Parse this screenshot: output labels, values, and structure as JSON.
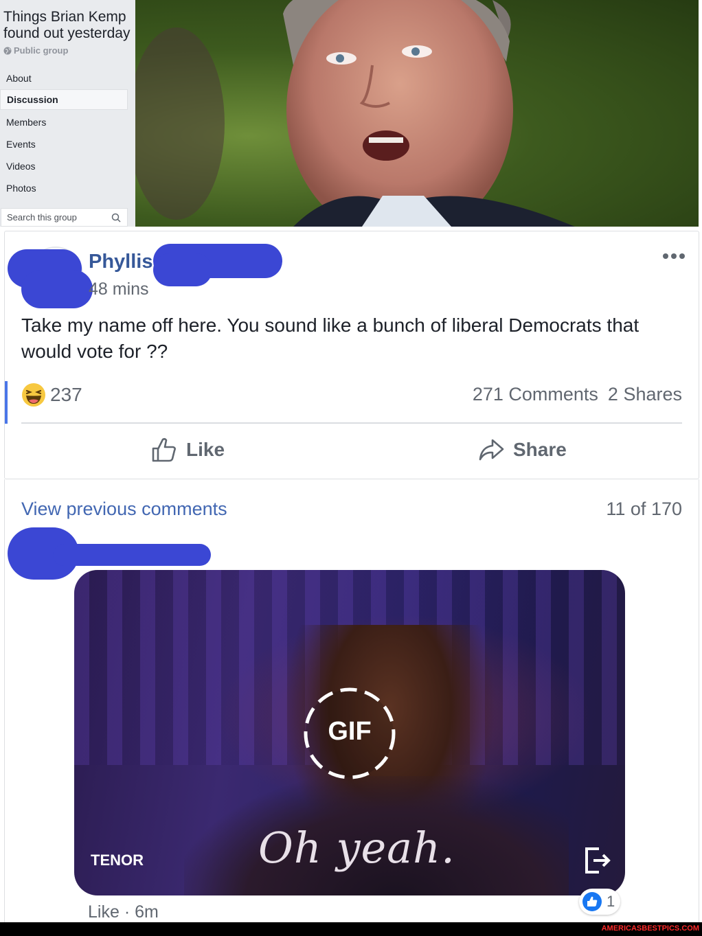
{
  "group": {
    "title": "Things Brian Kemp found out yesterday",
    "privacy": "Public group",
    "nav": [
      {
        "label": "About"
      },
      {
        "label": "Discussion",
        "active": true
      },
      {
        "label": "Members"
      },
      {
        "label": "Events"
      },
      {
        "label": "Videos"
      },
      {
        "label": "Photos"
      }
    ],
    "search_placeholder": "Search this group"
  },
  "post": {
    "author": "Phyllis",
    "time": "48 mins",
    "text": "Take my name off here. You sound like a bunch of liberal Democrats that would vote for ??",
    "reaction_count": "237",
    "comments_label": "271 Comments",
    "shares_label": "2 Shares",
    "actions": {
      "like": "Like",
      "share": "Share"
    }
  },
  "comments": {
    "view_previous": "View previous comments",
    "count_label": "11 of 170",
    "gif": {
      "badge": "GIF",
      "caption": "Oh yeah.",
      "provider": "TENOR"
    },
    "meta": {
      "like": "Like",
      "separator": "·",
      "time": "6m"
    },
    "reaction_count": "1"
  },
  "watermark": "AMERICASBESTPICS.COM",
  "colors": {
    "link": "#365899",
    "redaction": "#3b47d4",
    "like_blue": "#1877f2",
    "watermark": "#ff2a2a"
  }
}
